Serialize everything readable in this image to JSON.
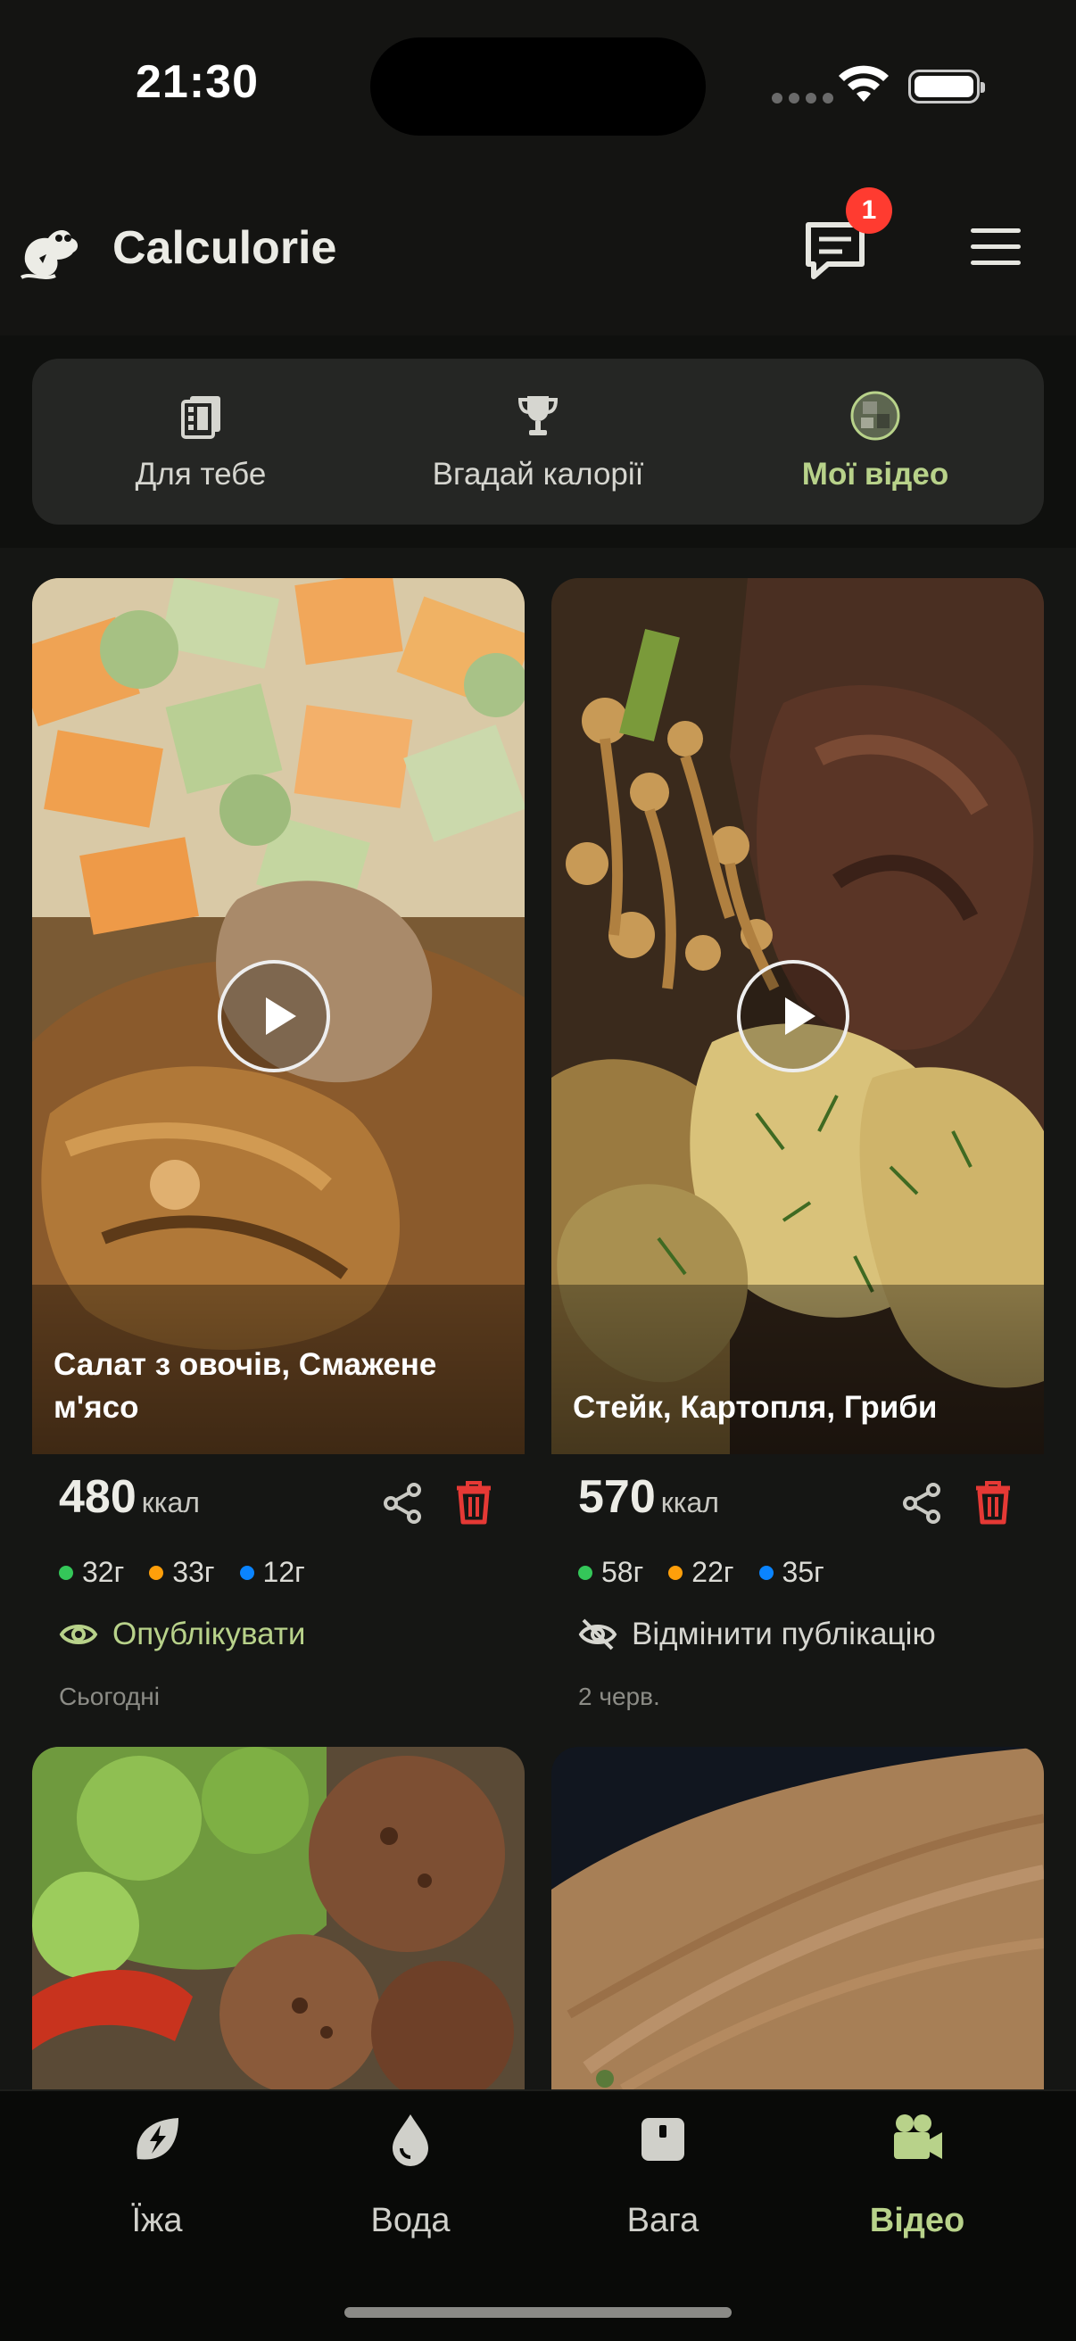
{
  "status_bar": {
    "time": "21:30"
  },
  "header": {
    "app_title": "Calculorie",
    "notification_count": "1"
  },
  "tabs": [
    {
      "label": "Для тебе",
      "icon": "film-stack-icon",
      "active": false
    },
    {
      "label": "Вгадай калорії",
      "icon": "trophy-icon",
      "active": false
    },
    {
      "label": "Мої відео",
      "icon": "avatar-icon",
      "active": true
    }
  ],
  "videos": [
    {
      "caption": "Салат з овочів, Смажене м'ясо",
      "kcal": "480",
      "kcal_unit": "ккал",
      "protein": "32г",
      "fat": "33г",
      "carbs": "12г",
      "publish_label": "Опублікувати",
      "date": "Сьогодні"
    },
    {
      "caption": "Стейк, Картопля, Гриби",
      "kcal": "570",
      "kcal_unit": "ккал",
      "protein": "58г",
      "fat": "22г",
      "carbs": "35г",
      "publish_label": "Відмінити публікацію",
      "date": "2 черв."
    }
  ],
  "bottom_nav": [
    {
      "label": "Їжа",
      "icon": "leaf-bolt-icon",
      "active": false
    },
    {
      "label": "Вода",
      "icon": "water-drop-icon",
      "active": false
    },
    {
      "label": "Вага",
      "icon": "scale-icon",
      "active": false
    },
    {
      "label": "Відео",
      "icon": "video-camera-icon",
      "active": true
    }
  ],
  "colors": {
    "accent": "#b8d28a",
    "protein": "#34c759",
    "fat": "#ff9f0a",
    "carbs": "#0a84ff",
    "delete": "#e53935",
    "badge": "#ff3b30"
  }
}
